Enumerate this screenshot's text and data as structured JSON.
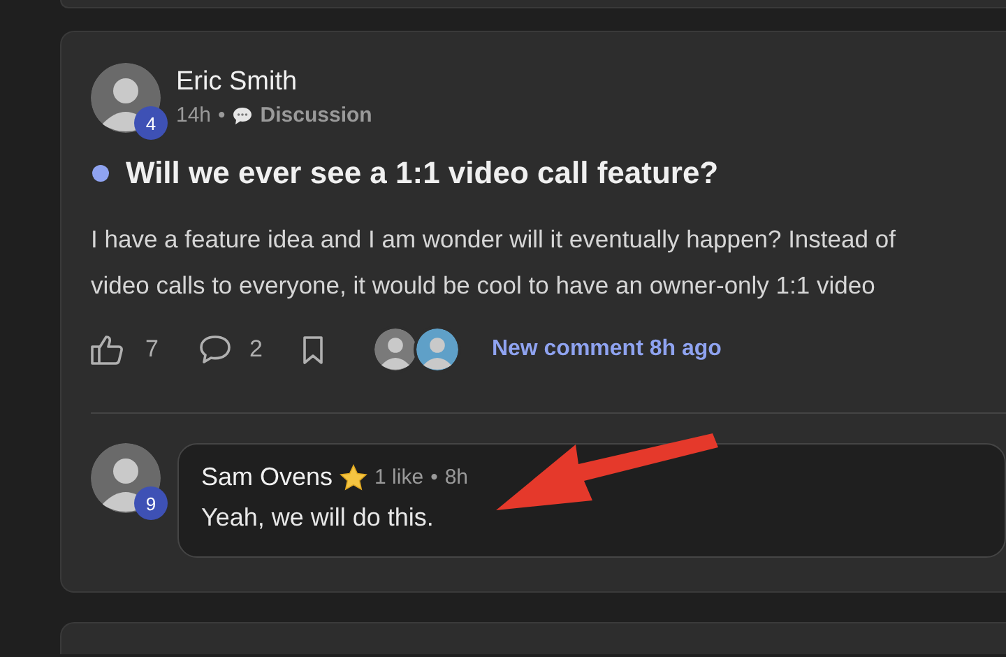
{
  "post": {
    "author": "Eric Smith",
    "level_badge": "4",
    "time": "14h",
    "separator": "•",
    "category": "Discussion",
    "unread": true,
    "title": "Will we ever see a 1:1 video call feature?",
    "body": "I have a feature idea and I am wonder will it eventually happen? Instead of\nvideo calls to everyone, it would be cool to have an owner-only 1:1 video",
    "likes": "7",
    "comments": "2",
    "bookmarked": false,
    "new_comment": "New comment 8h ago"
  },
  "comment": {
    "author": "Sam Ovens",
    "level_badge": "9",
    "starred": true,
    "likes": "1 like",
    "separator": "•",
    "time": "8h",
    "text": "Yeah, we will do this."
  }
}
